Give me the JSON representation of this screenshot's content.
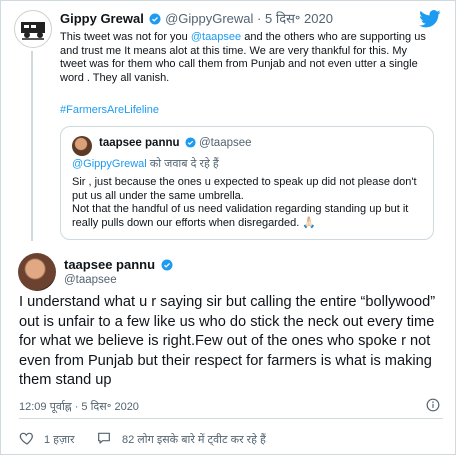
{
  "top_tweet": {
    "name": "Gippy Grewal",
    "handle": "@GippyGrewal",
    "separator": "·",
    "date": "5 दिस॰ 2020",
    "text_before_mention": "This tweet was not for you ",
    "mention": "@taapsee",
    "text_after_mention": " and the others who are supporting us and trust me It means alot at this time. We are very thankful for this. My tweet was for them who call them from Punjab and not even utter a single word . They all vanish.",
    "hashtag": "#FarmersAreLifeline"
  },
  "quoted_tweet": {
    "name": "taapsee pannu",
    "handle": "@taapsee",
    "reply_mention": "@GippyGrewal",
    "reply_suffix": " को जवाब दे रहे हैं",
    "text_p1": "Sir , just because the ones u expected to speak up did not please don't put us all under the same umbrella.",
    "text_p2": "Not that the handful of us need validation regarding standing up but it really pulls down our efforts when disregarded. 🙏🏻"
  },
  "main_tweet": {
    "name": "taapsee pannu",
    "handle": "@taapsee",
    "text": "I understand what u r saying sir but calling the entire “bollywood” out is unfair to a few like us who do stick the neck out every time for what we believe is right.Few out of the ones who spoke r not even from Punjab but their respect for farmers is what is making them stand up",
    "timestamp": "12:09 पूर्वाह्न · 5 दिस॰ 2020",
    "likes": "1 हज़ार",
    "talk": "82 लोग इसके बारे में ट्वीट कर रहे हैं"
  },
  "icons": {
    "brand": "twitter-bird-icon",
    "verified": "verified-badge-icon",
    "info": "info-icon",
    "like": "heart-icon",
    "talk": "speech-bubble-icon"
  },
  "colors": {
    "accent": "#1d9bf0",
    "muted": "#536471",
    "border": "#cfd9de",
    "like": "#f91880"
  }
}
